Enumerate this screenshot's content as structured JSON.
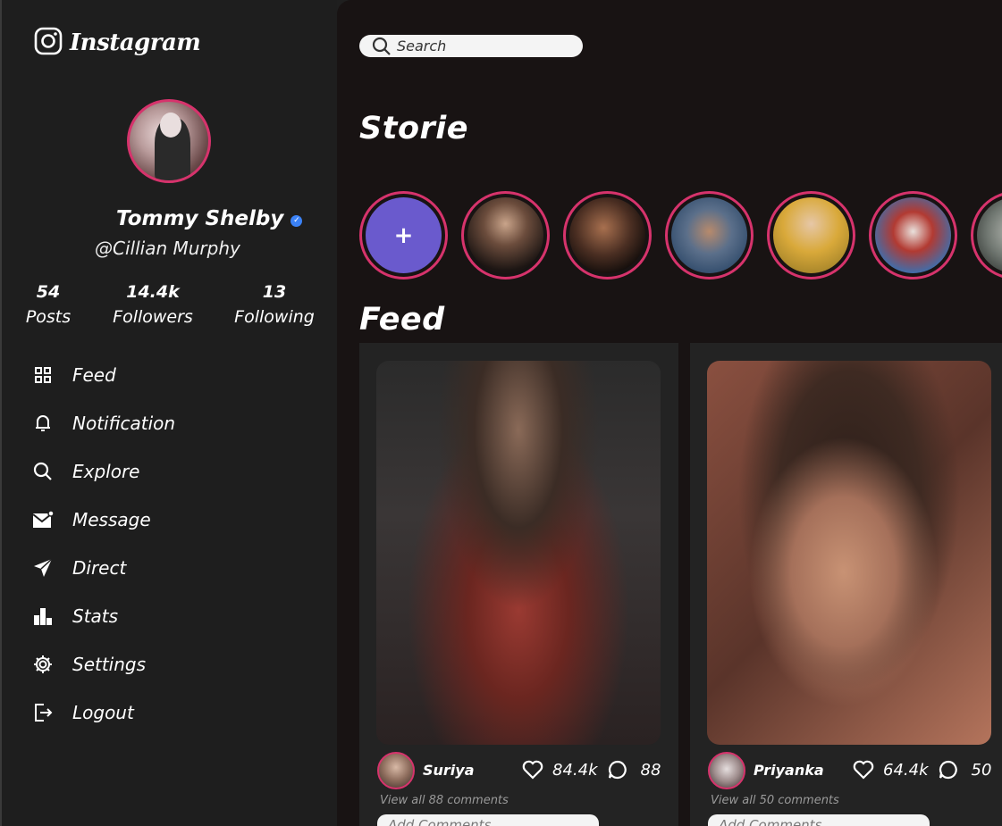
{
  "app": {
    "logo_text": "Instagram"
  },
  "profile": {
    "name": "Tommy Shelby",
    "handle": "@Cillian Murphy",
    "stats": [
      {
        "value": "54",
        "label": "Posts"
      },
      {
        "value": "14.4k",
        "label": "Followers"
      },
      {
        "value": "13",
        "label": "Following"
      }
    ]
  },
  "nav": {
    "items": [
      {
        "label": "Feed",
        "icon": "grid-icon"
      },
      {
        "label": "Notification",
        "icon": "bell-icon"
      },
      {
        "label": "Explore",
        "icon": "search-icon"
      },
      {
        "label": "Message",
        "icon": "mail-icon"
      },
      {
        "label": "Direct",
        "icon": "send-icon"
      },
      {
        "label": "Stats",
        "icon": "bar-chart-icon"
      },
      {
        "label": "Settings",
        "icon": "gear-icon"
      },
      {
        "label": "Logout",
        "icon": "logout-icon"
      }
    ]
  },
  "search": {
    "placeholder": "Search"
  },
  "stories": {
    "title": "Storie",
    "add_symbol": "+"
  },
  "feed": {
    "title": "Feed",
    "posts": [
      {
        "user": "Suriya",
        "likes": "84.4k",
        "comments": "88",
        "view_all": "View all 88 comments",
        "add_comment_placeholder": "Add Comments"
      },
      {
        "user": "Priyanka",
        "likes": "64.4k",
        "comments": "50",
        "view_all": "View all 50 comments",
        "add_comment_placeholder": "Add Comments"
      }
    ]
  },
  "colors": {
    "accent": "#d6336c",
    "verified": "#3b82f6",
    "sidebar_bg": "#1e1e1e",
    "main_bg": "#181313",
    "card_bg": "#232323"
  }
}
